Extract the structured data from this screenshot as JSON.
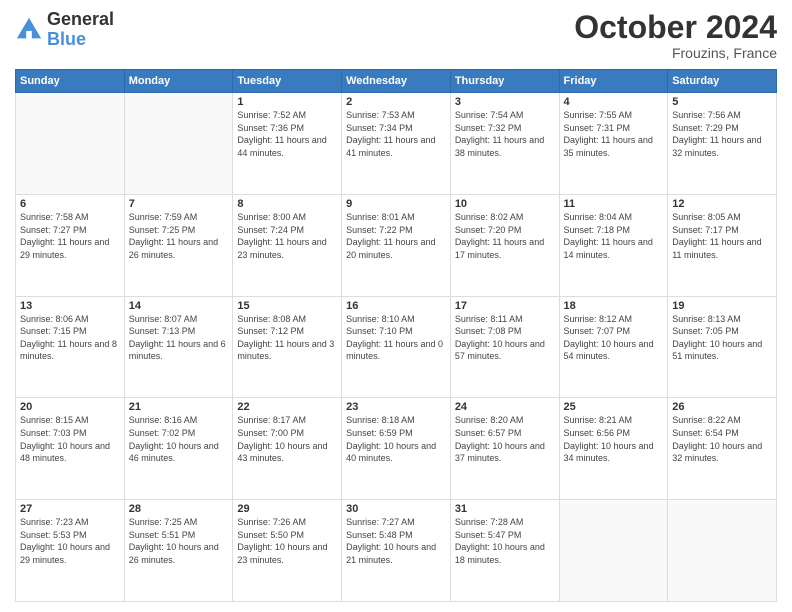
{
  "header": {
    "logo_text_general": "General",
    "logo_text_blue": "Blue",
    "month_title": "October 2024",
    "location": "Frouzins, France"
  },
  "weekdays": [
    "Sunday",
    "Monday",
    "Tuesday",
    "Wednesday",
    "Thursday",
    "Friday",
    "Saturday"
  ],
  "weeks": [
    [
      {
        "day": "",
        "sunrise": "",
        "sunset": "",
        "daylight": ""
      },
      {
        "day": "",
        "sunrise": "",
        "sunset": "",
        "daylight": ""
      },
      {
        "day": "1",
        "sunrise": "Sunrise: 7:52 AM",
        "sunset": "Sunset: 7:36 PM",
        "daylight": "Daylight: 11 hours and 44 minutes."
      },
      {
        "day": "2",
        "sunrise": "Sunrise: 7:53 AM",
        "sunset": "Sunset: 7:34 PM",
        "daylight": "Daylight: 11 hours and 41 minutes."
      },
      {
        "day": "3",
        "sunrise": "Sunrise: 7:54 AM",
        "sunset": "Sunset: 7:32 PM",
        "daylight": "Daylight: 11 hours and 38 minutes."
      },
      {
        "day": "4",
        "sunrise": "Sunrise: 7:55 AM",
        "sunset": "Sunset: 7:31 PM",
        "daylight": "Daylight: 11 hours and 35 minutes."
      },
      {
        "day": "5",
        "sunrise": "Sunrise: 7:56 AM",
        "sunset": "Sunset: 7:29 PM",
        "daylight": "Daylight: 11 hours and 32 minutes."
      }
    ],
    [
      {
        "day": "6",
        "sunrise": "Sunrise: 7:58 AM",
        "sunset": "Sunset: 7:27 PM",
        "daylight": "Daylight: 11 hours and 29 minutes."
      },
      {
        "day": "7",
        "sunrise": "Sunrise: 7:59 AM",
        "sunset": "Sunset: 7:25 PM",
        "daylight": "Daylight: 11 hours and 26 minutes."
      },
      {
        "day": "8",
        "sunrise": "Sunrise: 8:00 AM",
        "sunset": "Sunset: 7:24 PM",
        "daylight": "Daylight: 11 hours and 23 minutes."
      },
      {
        "day": "9",
        "sunrise": "Sunrise: 8:01 AM",
        "sunset": "Sunset: 7:22 PM",
        "daylight": "Daylight: 11 hours and 20 minutes."
      },
      {
        "day": "10",
        "sunrise": "Sunrise: 8:02 AM",
        "sunset": "Sunset: 7:20 PM",
        "daylight": "Daylight: 11 hours and 17 minutes."
      },
      {
        "day": "11",
        "sunrise": "Sunrise: 8:04 AM",
        "sunset": "Sunset: 7:18 PM",
        "daylight": "Daylight: 11 hours and 14 minutes."
      },
      {
        "day": "12",
        "sunrise": "Sunrise: 8:05 AM",
        "sunset": "Sunset: 7:17 PM",
        "daylight": "Daylight: 11 hours and 11 minutes."
      }
    ],
    [
      {
        "day": "13",
        "sunrise": "Sunrise: 8:06 AM",
        "sunset": "Sunset: 7:15 PM",
        "daylight": "Daylight: 11 hours and 8 minutes."
      },
      {
        "day": "14",
        "sunrise": "Sunrise: 8:07 AM",
        "sunset": "Sunset: 7:13 PM",
        "daylight": "Daylight: 11 hours and 6 minutes."
      },
      {
        "day": "15",
        "sunrise": "Sunrise: 8:08 AM",
        "sunset": "Sunset: 7:12 PM",
        "daylight": "Daylight: 11 hours and 3 minutes."
      },
      {
        "day": "16",
        "sunrise": "Sunrise: 8:10 AM",
        "sunset": "Sunset: 7:10 PM",
        "daylight": "Daylight: 11 hours and 0 minutes."
      },
      {
        "day": "17",
        "sunrise": "Sunrise: 8:11 AM",
        "sunset": "Sunset: 7:08 PM",
        "daylight": "Daylight: 10 hours and 57 minutes."
      },
      {
        "day": "18",
        "sunrise": "Sunrise: 8:12 AM",
        "sunset": "Sunset: 7:07 PM",
        "daylight": "Daylight: 10 hours and 54 minutes."
      },
      {
        "day": "19",
        "sunrise": "Sunrise: 8:13 AM",
        "sunset": "Sunset: 7:05 PM",
        "daylight": "Daylight: 10 hours and 51 minutes."
      }
    ],
    [
      {
        "day": "20",
        "sunrise": "Sunrise: 8:15 AM",
        "sunset": "Sunset: 7:03 PM",
        "daylight": "Daylight: 10 hours and 48 minutes."
      },
      {
        "day": "21",
        "sunrise": "Sunrise: 8:16 AM",
        "sunset": "Sunset: 7:02 PM",
        "daylight": "Daylight: 10 hours and 46 minutes."
      },
      {
        "day": "22",
        "sunrise": "Sunrise: 8:17 AM",
        "sunset": "Sunset: 7:00 PM",
        "daylight": "Daylight: 10 hours and 43 minutes."
      },
      {
        "day": "23",
        "sunrise": "Sunrise: 8:18 AM",
        "sunset": "Sunset: 6:59 PM",
        "daylight": "Daylight: 10 hours and 40 minutes."
      },
      {
        "day": "24",
        "sunrise": "Sunrise: 8:20 AM",
        "sunset": "Sunset: 6:57 PM",
        "daylight": "Daylight: 10 hours and 37 minutes."
      },
      {
        "day": "25",
        "sunrise": "Sunrise: 8:21 AM",
        "sunset": "Sunset: 6:56 PM",
        "daylight": "Daylight: 10 hours and 34 minutes."
      },
      {
        "day": "26",
        "sunrise": "Sunrise: 8:22 AM",
        "sunset": "Sunset: 6:54 PM",
        "daylight": "Daylight: 10 hours and 32 minutes."
      }
    ],
    [
      {
        "day": "27",
        "sunrise": "Sunrise: 7:23 AM",
        "sunset": "Sunset: 5:53 PM",
        "daylight": "Daylight: 10 hours and 29 minutes."
      },
      {
        "day": "28",
        "sunrise": "Sunrise: 7:25 AM",
        "sunset": "Sunset: 5:51 PM",
        "daylight": "Daylight: 10 hours and 26 minutes."
      },
      {
        "day": "29",
        "sunrise": "Sunrise: 7:26 AM",
        "sunset": "Sunset: 5:50 PM",
        "daylight": "Daylight: 10 hours and 23 minutes."
      },
      {
        "day": "30",
        "sunrise": "Sunrise: 7:27 AM",
        "sunset": "Sunset: 5:48 PM",
        "daylight": "Daylight: 10 hours and 21 minutes."
      },
      {
        "day": "31",
        "sunrise": "Sunrise: 7:28 AM",
        "sunset": "Sunset: 5:47 PM",
        "daylight": "Daylight: 10 hours and 18 minutes."
      },
      {
        "day": "",
        "sunrise": "",
        "sunset": "",
        "daylight": ""
      },
      {
        "day": "",
        "sunrise": "",
        "sunset": "",
        "daylight": ""
      }
    ]
  ]
}
